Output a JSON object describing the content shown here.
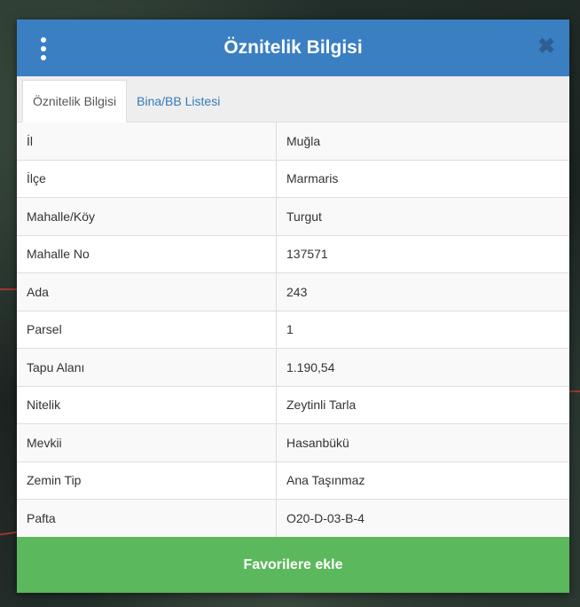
{
  "header": {
    "title": "Öznitelik Bilgisi",
    "menu_icon": "vertical-dots-icon",
    "close_icon": "close-icon"
  },
  "tabs": [
    {
      "label": "Öznitelik Bilgisi",
      "active": true
    },
    {
      "label": "Bina/BB Listesi",
      "active": false
    }
  ],
  "attributes": [
    {
      "key": "İl",
      "value": "Muğla"
    },
    {
      "key": "İlçe",
      "value": "Marmaris"
    },
    {
      "key": "Mahalle/Köy",
      "value": "Turgut"
    },
    {
      "key": "Mahalle No",
      "value": "137571"
    },
    {
      "key": "Ada",
      "value": "243"
    },
    {
      "key": "Parsel",
      "value": "1"
    },
    {
      "key": "Tapu Alanı",
      "value": "1.190,54"
    },
    {
      "key": "Nitelik",
      "value": "Zeytinli Tarla"
    },
    {
      "key": "Mevkii",
      "value": "Hasanbükü"
    },
    {
      "key": "Zemin Tip",
      "value": "Ana Taşınmaz"
    },
    {
      "key": "Pafta",
      "value": "O20-D-03-B-4"
    }
  ],
  "footer": {
    "button_label": "Favorilere ekle"
  },
  "colors": {
    "header_bg": "#3a7fc2",
    "button_bg": "#5cb85c",
    "tab_link": "#337ab7"
  }
}
